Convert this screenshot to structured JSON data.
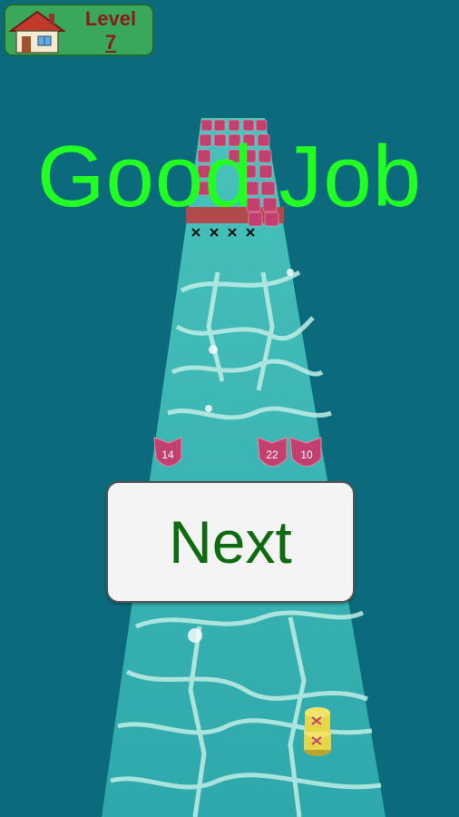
{
  "hud": {
    "level_label": "Level",
    "level_number": "7",
    "home_icon": "house-icon"
  },
  "title": "Good Job",
  "next_button": {
    "label": "Next"
  },
  "enemies": [
    {
      "value": "14"
    },
    {
      "value": "22"
    },
    {
      "value": "10"
    }
  ],
  "colors": {
    "background": "#0b6b7c",
    "road": "#3fb8b0",
    "title": "#22ff22",
    "next_text": "#0f6b0f",
    "hud_panel": "#3aa85a",
    "level_text": "#8b1b1b",
    "enemy_shield": "#c2406e",
    "player_coin": "#e7d64a"
  }
}
